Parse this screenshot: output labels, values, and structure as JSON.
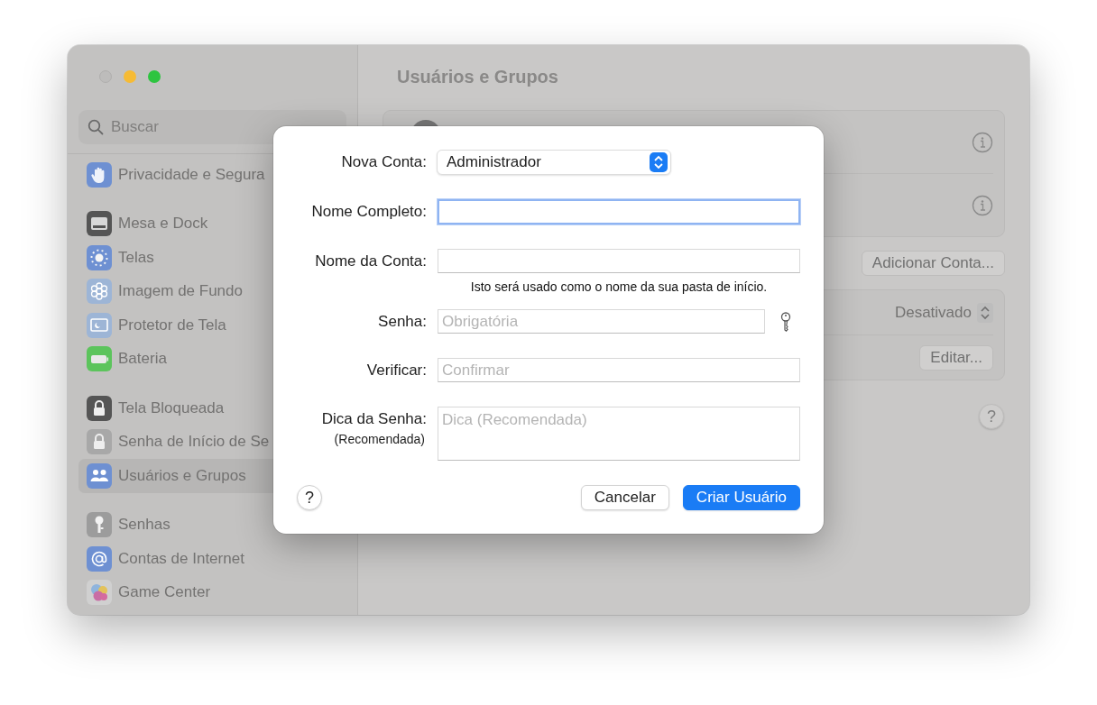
{
  "sidebar": {
    "search": {
      "placeholder": "Buscar"
    },
    "sections": [
      {
        "items": [
          {
            "label": "Privacidade e Segura",
            "kind": "hand",
            "color": "#6e90d2",
            "selected": false
          }
        ]
      },
      {
        "items": [
          {
            "label": "Mesa e Dock",
            "kind": "dock",
            "color": "#555555",
            "selected": false
          },
          {
            "label": "Telas",
            "kind": "sun",
            "color": "#6e90d2",
            "selected": false
          },
          {
            "label": "Imagem de Fundo",
            "kind": "flower",
            "color": "#9db5d6",
            "selected": false
          },
          {
            "label": "Protetor de Tela",
            "kind": "screen",
            "color": "#9db5d6",
            "selected": false
          },
          {
            "label": "Bateria",
            "kind": "battery",
            "color": "#5cc45c",
            "selected": false
          }
        ]
      },
      {
        "items": [
          {
            "label": "Tela Bloqueada",
            "kind": "lock",
            "color": "#555555",
            "selected": false
          },
          {
            "label": "Senha de Início de Se",
            "kind": "lock",
            "color": "#a8a8a8",
            "selected": false
          },
          {
            "label": "Usuários e Grupos",
            "kind": "people",
            "color": "#6e90d2",
            "selected": true
          }
        ]
      },
      {
        "items": [
          {
            "label": "Senhas",
            "kind": "key",
            "color": "#9c9c9c",
            "selected": false
          },
          {
            "label": "Contas de Internet",
            "kind": "at",
            "color": "#6e90d2",
            "selected": false
          },
          {
            "label": "Game Center",
            "kind": "bubbles",
            "color": "#d0d0d0",
            "selected": false
          }
        ]
      }
    ]
  },
  "content": {
    "title": "Usuários e Grupos",
    "add_button": "Adicionar Conta...",
    "setting_value": "Desativado",
    "edit_button": "Editar...",
    "help_button": "?"
  },
  "dialog": {
    "fields": [
      {
        "kind": "popup",
        "label": "Nova Conta:",
        "value": "Administrador"
      },
      {
        "kind": "text",
        "label": "Nome Completo:",
        "focused": true
      },
      {
        "kind": "text",
        "label": "Nome da Conta:",
        "focused": false,
        "note": "Isto será usado como o nome da sua pasta de início."
      },
      {
        "kind": "password",
        "label": "Senha:",
        "placeholder": "Obrigatória",
        "focused": false
      },
      {
        "kind": "text",
        "label": "Verificar:",
        "placeholder": "Confirmar",
        "focused": false
      },
      {
        "kind": "textarea",
        "label": "Dica da Senha:",
        "sublabel": "(Recomendada)",
        "placeholder": "Dica (Recomendada)",
        "focused": false
      }
    ],
    "help_button": "?",
    "buttons": [
      {
        "label": "Cancelar",
        "default": false
      },
      {
        "label": "Criar Usuário",
        "default": true
      }
    ]
  }
}
